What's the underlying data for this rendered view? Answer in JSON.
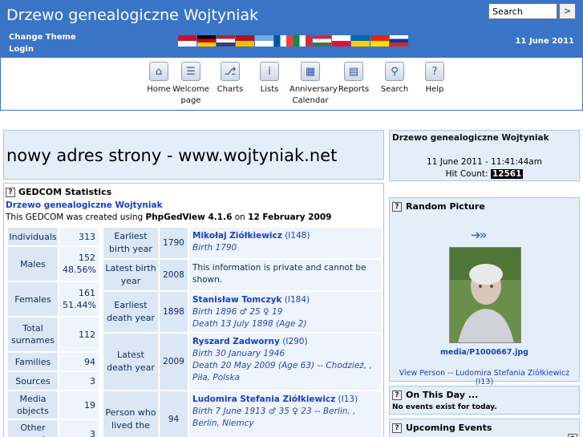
{
  "header": {
    "title": "Drzewo genealogiczne Wojtyniak",
    "search_placeholder": "Search",
    "search_go": ">",
    "change_theme": "Change Theme",
    "login": "Login",
    "date": "11 June 2011",
    "flags": [
      {
        "name": "flag-danish",
        "colors": [
          "#c8102e",
          "#ffffff"
        ]
      },
      {
        "name": "flag-german",
        "colors": [
          "#000000",
          "#dd0000",
          "#ffce00"
        ]
      },
      {
        "name": "flag-english",
        "colors": [
          "#b22234",
          "#ffffff",
          "#3c3b6e"
        ]
      },
      {
        "name": "flag-spanish",
        "colors": [
          "#aa151b",
          "#f1bf00"
        ]
      },
      {
        "name": "flag-argentinian",
        "colors": [
          "#74acdf",
          "#ffffff"
        ]
      },
      {
        "name": "flag-french",
        "colors": [
          "#0055a4",
          "#ffffff",
          "#ef4135"
        ]
      },
      {
        "name": "flag-italian",
        "colors": [
          "#009246",
          "#ffffff",
          "#ce2b37"
        ]
      },
      {
        "name": "flag-hungarian",
        "colors": [
          "#ce2939",
          "#ffffff",
          "#477050"
        ]
      },
      {
        "name": "flag-polish",
        "colors": [
          "#ffffff",
          "#dc143c"
        ]
      },
      {
        "name": "flag-swedish",
        "colors": [
          "#006aa7",
          "#fecc00"
        ]
      },
      {
        "name": "flag-chinese",
        "colors": [
          "#de2910",
          "#ffde00"
        ]
      },
      {
        "name": "flag-russian",
        "colors": [
          "#ffffff",
          "#0039a6",
          "#d52b1e"
        ]
      }
    ]
  },
  "menu": [
    {
      "label": "Home",
      "icon": "house-icon",
      "glyph": "⌂"
    },
    {
      "label": "Welcome page",
      "icon": "welcome-page-icon",
      "glyph": "☰"
    },
    {
      "label": "Charts",
      "icon": "charts-icon",
      "glyph": "⎇"
    },
    {
      "label": "Lists",
      "icon": "lists-icon",
      "glyph": "i"
    },
    {
      "label": "Anniversary Calendar",
      "icon": "calendar-icon",
      "glyph": "▦"
    },
    {
      "label": "Reports",
      "icon": "reports-icon",
      "glyph": "▤"
    },
    {
      "label": "Search",
      "icon": "search-icon",
      "glyph": "⚲"
    },
    {
      "label": "Help",
      "icon": "help-icon",
      "glyph": "?"
    }
  ],
  "headline": "nowy adres strony - www.wojtyniak.net",
  "stats": {
    "title": "GEDCOM Statistics",
    "gedcom_name": "Drzewo genealogiczne Wojtyniak",
    "created_prefix": "This GEDCOM was created using ",
    "software": "PhpGedView 4.1.6",
    "created_on": " on ",
    "created_date": "12 February 2009",
    "counts": [
      {
        "label": "Individuals",
        "value": "313"
      },
      {
        "label": "Males",
        "value": "152",
        "sub": "48.56%"
      },
      {
        "label": "Females",
        "value": "161",
        "sub": "51.44%"
      },
      {
        "label": "Total surnames",
        "value": "112"
      },
      {
        "label": "Families",
        "value": "94"
      },
      {
        "label": "Sources",
        "value": "3"
      },
      {
        "label": "Media objects",
        "value": "19"
      },
      {
        "label": "Other records",
        "value": "3"
      }
    ],
    "facts": [
      {
        "label": "Earliest birth year",
        "year": "1790",
        "name": "Mikołaj Ziółkiewicz",
        "pid": "(I148)",
        "lines": [
          "Birth 1790"
        ]
      },
      {
        "label": "Latest birth year",
        "year": "2008",
        "plain": "This information is private and cannot be shown."
      },
      {
        "label": "Earliest death year",
        "year": "1898",
        "name": "Stanisław Tomczyk",
        "pid": "(I184)",
        "lines": [
          "Birth 1896 ♂ 25 ♀ 19",
          "Death 13 July 1898 (Age 2)"
        ]
      },
      {
        "label": "Latest death year",
        "year": "2009",
        "name": "Ryszard Zadworny",
        "pid": "(I290)",
        "lines": [
          "Birth 30 January 1946",
          "Death 20 May 2009 (Age 63) -- Chodzież, , Piła, Polska"
        ]
      },
      {
        "label": "Person who lived the",
        "year": "94",
        "name": "Ludomira Stefania Ziółkiewicz",
        "pid": "(I13)",
        "lines": [
          "Birth 7 June 1913 ♂ 35 ♀ 23 -- Berlin, , Berlin, Niemcy"
        ]
      }
    ]
  },
  "sidebar": {
    "site_title": "Drzewo genealogiczne Wojtyniak",
    "datetime": "11 June 2011 - 11:41:44am",
    "hit_label": "Hit Count: ",
    "hit_count": "12561",
    "random_title": "Random Picture",
    "photo_link": "media/P1000667.jpg",
    "view_person": "View Person -- Ludomira Stefania Ziółkiewicz  (I13)",
    "onthisday_title": "On This Day ...",
    "onthisday_text": "No events exist for today.",
    "upcoming_title": "Upcoming Events"
  },
  "colors": {
    "header_bg": "#3a74c7",
    "box_bg": "#e4eef9",
    "link": "#1a3fc4"
  }
}
